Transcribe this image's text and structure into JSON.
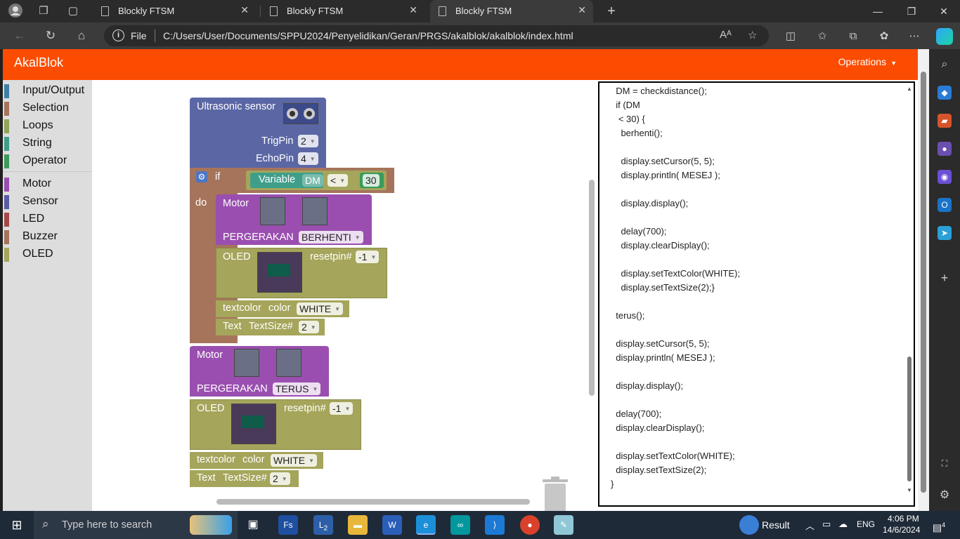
{
  "browser": {
    "tabs": [
      {
        "title": "Blockly FTSM",
        "active": false
      },
      {
        "title": "Blockly FTSM",
        "active": false
      },
      {
        "title": "Blockly FTSM",
        "active": true
      }
    ],
    "address_scheme": "File",
    "url": "C:/Users/User/Documents/SPPU2024/Penyelidikan/Geran/PRGS/akalblok/akalblok/index.html"
  },
  "app": {
    "brand": "AkalBlok",
    "menu_label": "Operations",
    "accent_color": "#fc4c02"
  },
  "toolbox": {
    "categories": [
      {
        "label": "Input/Output",
        "color": "#3f7fa6"
      },
      {
        "label": "Selection",
        "color": "#a5745b"
      },
      {
        "label": "Loops",
        "color": "#8fa557"
      },
      {
        "label": "String",
        "color": "#3f9e8a"
      },
      {
        "label": "Operator",
        "color": "#3a9a5b"
      },
      {
        "label": "Motor",
        "color": "#9a4fb0"
      },
      {
        "label": "Sensor",
        "color": "#5b5ba5"
      },
      {
        "label": "LED",
        "color": "#a54848"
      },
      {
        "label": "Buzzer",
        "color": "#a5745b"
      },
      {
        "label": "OLED",
        "color": "#a5a55b"
      }
    ]
  },
  "blocks": {
    "ultrasonic": {
      "title": "Ultrasonic sensor",
      "trig_label": "TrigPin",
      "trig_value": "2",
      "echo_label": "EchoPin",
      "echo_value": "4"
    },
    "if_block": {
      "if_label": "if",
      "do_label": "do"
    },
    "condition": {
      "var_label": "Variable",
      "var_name": "DM",
      "operator": "<",
      "number": "30"
    },
    "motor1": {
      "title": "Motor",
      "move_label": "PERGERAKAN",
      "move_value": "BERHENTI"
    },
    "oled1": {
      "title": "OLED",
      "reset_label": "resetpin#",
      "reset_value": "-1"
    },
    "textcolor1": {
      "label": "textcolor",
      "color_label": "color",
      "color_value": "WHITE"
    },
    "textsize1": {
      "label": "Text",
      "size_label": "TextSize#",
      "size_value": "2"
    },
    "motor2": {
      "title": "Motor",
      "move_label": "PERGERAKAN",
      "move_value": "TERUS"
    },
    "oled2": {
      "title": "OLED",
      "reset_label": "resetpin#",
      "reset_value": "-1"
    },
    "textcolor2": {
      "label": "textcolor",
      "color_label": "color",
      "color_value": "WHITE"
    },
    "textsize2": {
      "label": "Text",
      "size_label": "TextSize#",
      "size_value": "2"
    }
  },
  "code_lines": [
    "  DM = checkdistance();",
    "  if (DM",
    "   < 30) {",
    "    berhenti();",
    "",
    "    display.setCursor(5, 5);",
    "    display.println( MESEJ );",
    "",
    "    display.display();",
    "",
    "    delay(700);",
    "    display.clearDisplay();",
    "",
    "    display.setTextColor(WHITE);",
    "    display.setTextSize(2);}",
    "",
    "  terus();",
    "",
    "  display.setCursor(5, 5);",
    "  display.println( MESEJ );",
    "",
    "  display.display();",
    "",
    "  delay(700);",
    "  display.clearDisplay();",
    "",
    "  display.setTextColor(WHITE);",
    "  display.setTextSize(2);",
    "}"
  ],
  "taskbar": {
    "search_placeholder": "Type here to search",
    "weather": "Result",
    "language": "ENG",
    "time": "4:06 PM",
    "date": "14/6/2024",
    "notification_count": "4",
    "badge_l": "2"
  }
}
